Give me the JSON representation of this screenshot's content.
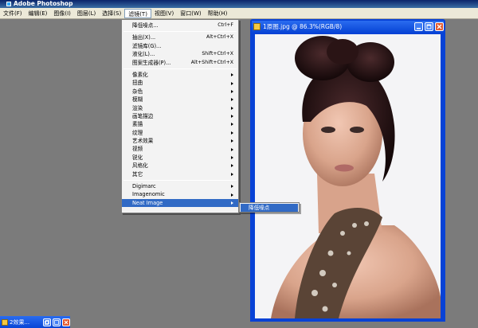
{
  "app": {
    "title": "Adobe Photoshop"
  },
  "menubar": {
    "items": [
      "文件(F)",
      "编辑(E)",
      "图像(I)",
      "图层(L)",
      "选择(S)",
      "滤镜(T)",
      "视图(V)",
      "窗口(W)",
      "帮助(H)"
    ],
    "active_index": 5
  },
  "filter_menu": {
    "last_filter": {
      "label": "降低噪点...",
      "shortcut": "Ctrl+F"
    },
    "group1": [
      {
        "label": "抽出(X)...",
        "shortcut": "Alt+Ctrl+X"
      },
      {
        "label": "滤镜库(G)...",
        "shortcut": ""
      },
      {
        "label": "液化(L)...",
        "shortcut": "Shift+Ctrl+X"
      },
      {
        "label": "图案生成器(P)...",
        "shortcut": "Alt+Shift+Ctrl+X"
      }
    ],
    "group2": [
      "像素化",
      "扭曲",
      "杂色",
      "模糊",
      "渲染",
      "画笔描边",
      "素描",
      "纹理",
      "艺术效果",
      "视频",
      "锐化",
      "风格化",
      "其它"
    ],
    "group3": [
      "Digimarc",
      "Imagenomic",
      "Neat Image"
    ]
  },
  "submenu": {
    "item": "降低噪点"
  },
  "document": {
    "title": "1原图.jpg @ 86.3%(RGB/8)"
  },
  "minimized": {
    "title": "2效果..."
  },
  "colors": {
    "highlight": "#316ac5",
    "window_blue": "#0842d6",
    "workspace": "#7b7b7b"
  }
}
